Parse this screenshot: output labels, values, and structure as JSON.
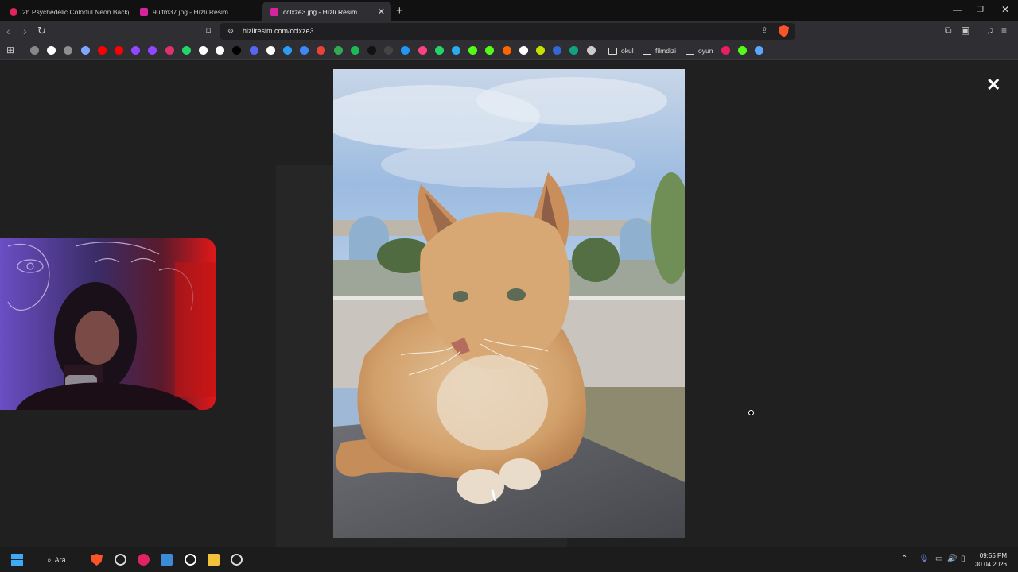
{
  "tabs": [
    {
      "label": "2h Psychedelic Colorful Neon Backgr",
      "favicon_color": "#e0245e"
    },
    {
      "label": "9uitm37.jpg - Hızlı Resim",
      "favicon_color": "#d6249f"
    },
    {
      "label": "cclxze3.jpg - Hızlı Resim",
      "favicon_color": "#d6249f"
    }
  ],
  "window_controls": {
    "minimize": "—",
    "restore": "❐",
    "close": "✕"
  },
  "address_bar": {
    "url": "hizliresim.com/cclxze3"
  },
  "bookmarks": {
    "icon_colors": [
      "#888888",
      "#ffffff",
      "#8e8e8e",
      "#7fa7ff",
      "#ff0000",
      "#ff0000",
      "#9146ff",
      "#9146ff",
      "#e1306c",
      "#25d366",
      "#ffffff",
      "#ffffff",
      "#000000",
      "#5865f2",
      "#ffffff",
      "#2a9df4",
      "#4285f4",
      "#ea4335",
      "#34a853",
      "#1db954",
      "#111111",
      "#444444",
      "#2196f3",
      "#ff4081",
      "#25d366",
      "#2aabee",
      "#53fc18",
      "#53fc18",
      "#ff6600",
      "#ffffff",
      "#c6e000",
      "#3367d6",
      "#10a37f",
      "#cccccc"
    ],
    "folders": [
      "okul",
      "filmdizi",
      "oyun"
    ],
    "trailing_icon_colors": [
      "#e91e63",
      "#53fc18",
      "#5aa7ff"
    ]
  },
  "viewer": {
    "close_glyph": "✕",
    "image_alt": "Orange tabby cat sitting on a stone ledge under a blue sky"
  },
  "taskbar": {
    "search_label": "Ara",
    "time": "09:55 PM",
    "date": "30.04.2026"
  }
}
